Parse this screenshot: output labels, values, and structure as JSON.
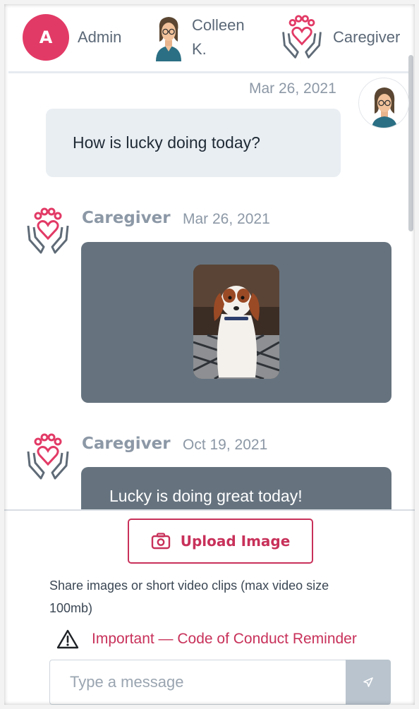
{
  "participants": [
    {
      "name": "Admin",
      "avatar_letter": "A",
      "avatar_color": "#e23a66"
    },
    {
      "name": "Colleen K."
    },
    {
      "name": "Caregiver"
    }
  ],
  "messages": [
    {
      "date": "Mar 26, 2021",
      "text": "How is lucky doing today?",
      "from": "me"
    },
    {
      "sender": "Caregiver",
      "date": "Mar 26, 2021",
      "type": "image",
      "image_icon": "dog-photo"
    },
    {
      "sender": "Caregiver",
      "date": "Oct 19, 2021",
      "text": "Lucky is doing great today!"
    }
  ],
  "composer": {
    "upload_label": "Upload Image",
    "upload_icon": "camera-icon",
    "hint": "Share images or short video clips (max video size 100mb)",
    "reminder_label": "Important — Code of Conduct Reminder",
    "reminder_icon": "warning-icon",
    "input_placeholder": "Type a message",
    "send_icon": "send-icon"
  },
  "colors": {
    "brand": "#c8315a",
    "admin_avatar": "#e23a66",
    "bubble_light": "#e9eef3",
    "bubble_dark": "#66737f",
    "send_button": "#b9c4ce"
  }
}
